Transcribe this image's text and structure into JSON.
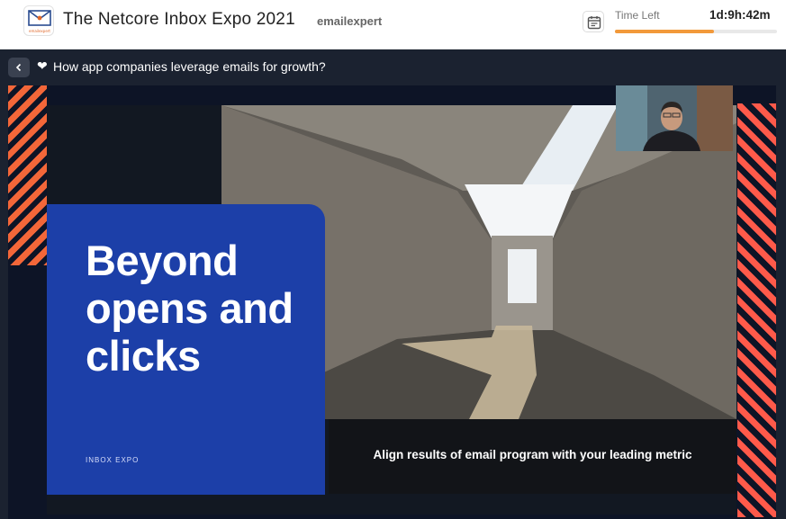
{
  "header": {
    "logo_label": "emailexpert",
    "event_title": "The Netcore Inbox Expo 2021",
    "brand": "emailexpert",
    "time_left_label": "Time Left",
    "time_left_value": "1d:9h:42m",
    "time_progress_percent": 61
  },
  "player": {
    "session_title": "How app companies leverage emails for growth?",
    "slide": {
      "headline": "Beyond opens and clicks",
      "tag": "INBOX EXPO",
      "caption": "Align results of email program with your leading metric"
    }
  },
  "colors": {
    "accent_orange": "#f2993a",
    "player_bg": "#1b2230",
    "card_blue": "#1c3fa8"
  },
  "icons": [
    "envelope-logo-icon",
    "calendar-icon",
    "chevron-left-icon",
    "heart-icon"
  ]
}
